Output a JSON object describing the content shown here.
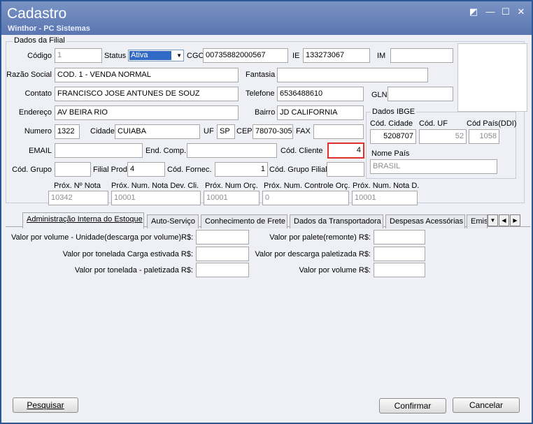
{
  "window": {
    "title": "Cadastro",
    "subtitle": "Winthor - PC Sistemas",
    "controls": [
      "◩",
      "—",
      "☐",
      "✕"
    ]
  },
  "filial": {
    "group_title": "Dados da Filial",
    "codigo": {
      "label": "Código",
      "value": "1"
    },
    "status": {
      "label": "Status",
      "value": "Ativa"
    },
    "cgc": {
      "label": "CGC",
      "value": "00735882000567"
    },
    "ie": {
      "label": "IE",
      "value": "133273067"
    },
    "im": {
      "label": "IM",
      "value": ""
    },
    "razao_social": {
      "label": "Razão Social",
      "value": "COD. 1 - VENDA NORMAL"
    },
    "fantasia": {
      "label": "Fantasia",
      "value": ""
    },
    "contato": {
      "label": "Contato",
      "value": "FRANCISCO JOSE ANTUNES DE SOUZ"
    },
    "telefone": {
      "label": "Telefone",
      "value": "6536488610"
    },
    "gln": {
      "label": "GLN",
      "value": ""
    },
    "endereco": {
      "label": "Endereço",
      "value": "AV BEIRA RIO"
    },
    "bairro": {
      "label": "Bairro",
      "value": "JD CALIFORNIA"
    },
    "numero": {
      "label": "Numero",
      "value": "1322"
    },
    "cidade": {
      "label": "Cidade",
      "value": "CUIABA"
    },
    "uf": {
      "label": "UF",
      "value": "SP"
    },
    "cep": {
      "label": "CEP",
      "value": "78070-305"
    },
    "fax": {
      "label": "FAX",
      "value": ""
    },
    "email": {
      "label": "EMAIL",
      "value": ""
    },
    "end_comp": {
      "label": "End. Comp.",
      "value": ""
    },
    "cod_cliente": {
      "label": "Cód. Cliente",
      "value": "4"
    },
    "cod_grupo": {
      "label": "Cód. Grupo",
      "value": ""
    },
    "filial_prod": {
      "label": "Filial Prod.",
      "value": "4"
    },
    "cod_fornec": {
      "label": "Cód. Fornec.",
      "value": "1"
    },
    "cod_grupo_filial": {
      "label": "Cód. Grupo Filial",
      "value": ""
    }
  },
  "ibge": {
    "group_title": "Dados IBGE",
    "cod_cidade": {
      "label": "Cód. Cidade",
      "value": "5208707"
    },
    "cod_uf": {
      "label": "Cód. UF",
      "value": "52"
    },
    "cod_pais": {
      "label": "Cód País(DDI)",
      "value": "1058"
    },
    "nome_pais": {
      "label": "Nome País",
      "value": "BRASIL"
    }
  },
  "proximos": {
    "prox_nota": {
      "label": "Próx. Nº Nota",
      "value": "10342"
    },
    "prox_nota_dev": {
      "label": "Próx. Num. Nota Dev. Cli.",
      "value": "10001"
    },
    "prox_orc": {
      "label": "Próx. Num Orç.",
      "value": "10001"
    },
    "prox_controle_orc": {
      "label": "Próx. Num. Controle Orç.",
      "value": "0"
    },
    "prox_nota_d": {
      "label": "Próx. Num. Nota D.",
      "value": "10001"
    }
  },
  "tabs": [
    "Administração Interna do Estoque",
    "Auto-Serviço",
    "Conhecimento de Frete",
    "Dados da Transportadora",
    "Despesas Acessórias",
    "Emiss"
  ],
  "estoque": {
    "valor_volume_unidade": {
      "label": "Valor por volume - Unidade(descarga por volume)R$:",
      "value": ""
    },
    "valor_palete": {
      "label": "Valor por palete(remonte) R$:",
      "value": ""
    },
    "valor_ton_estivada": {
      "label": "Valor por tonelada Carga estivada R$:",
      "value": ""
    },
    "valor_descarga_paletizada": {
      "label": "Valor por descarga paletizada R$:",
      "value": ""
    },
    "valor_ton_paletizada": {
      "label": "Valor por tonelada - paletizada R$:",
      "value": ""
    },
    "valor_volume": {
      "label": "Valor por volume R$:",
      "value": ""
    }
  },
  "buttons": {
    "pesquisar": "Pesquisar",
    "confirmar": "Confirmar",
    "cancelar": "Cancelar"
  },
  "colors": {
    "titlebar": "#5a76b0",
    "highlight_border": "#e0302a",
    "selection": "#3169c6"
  }
}
